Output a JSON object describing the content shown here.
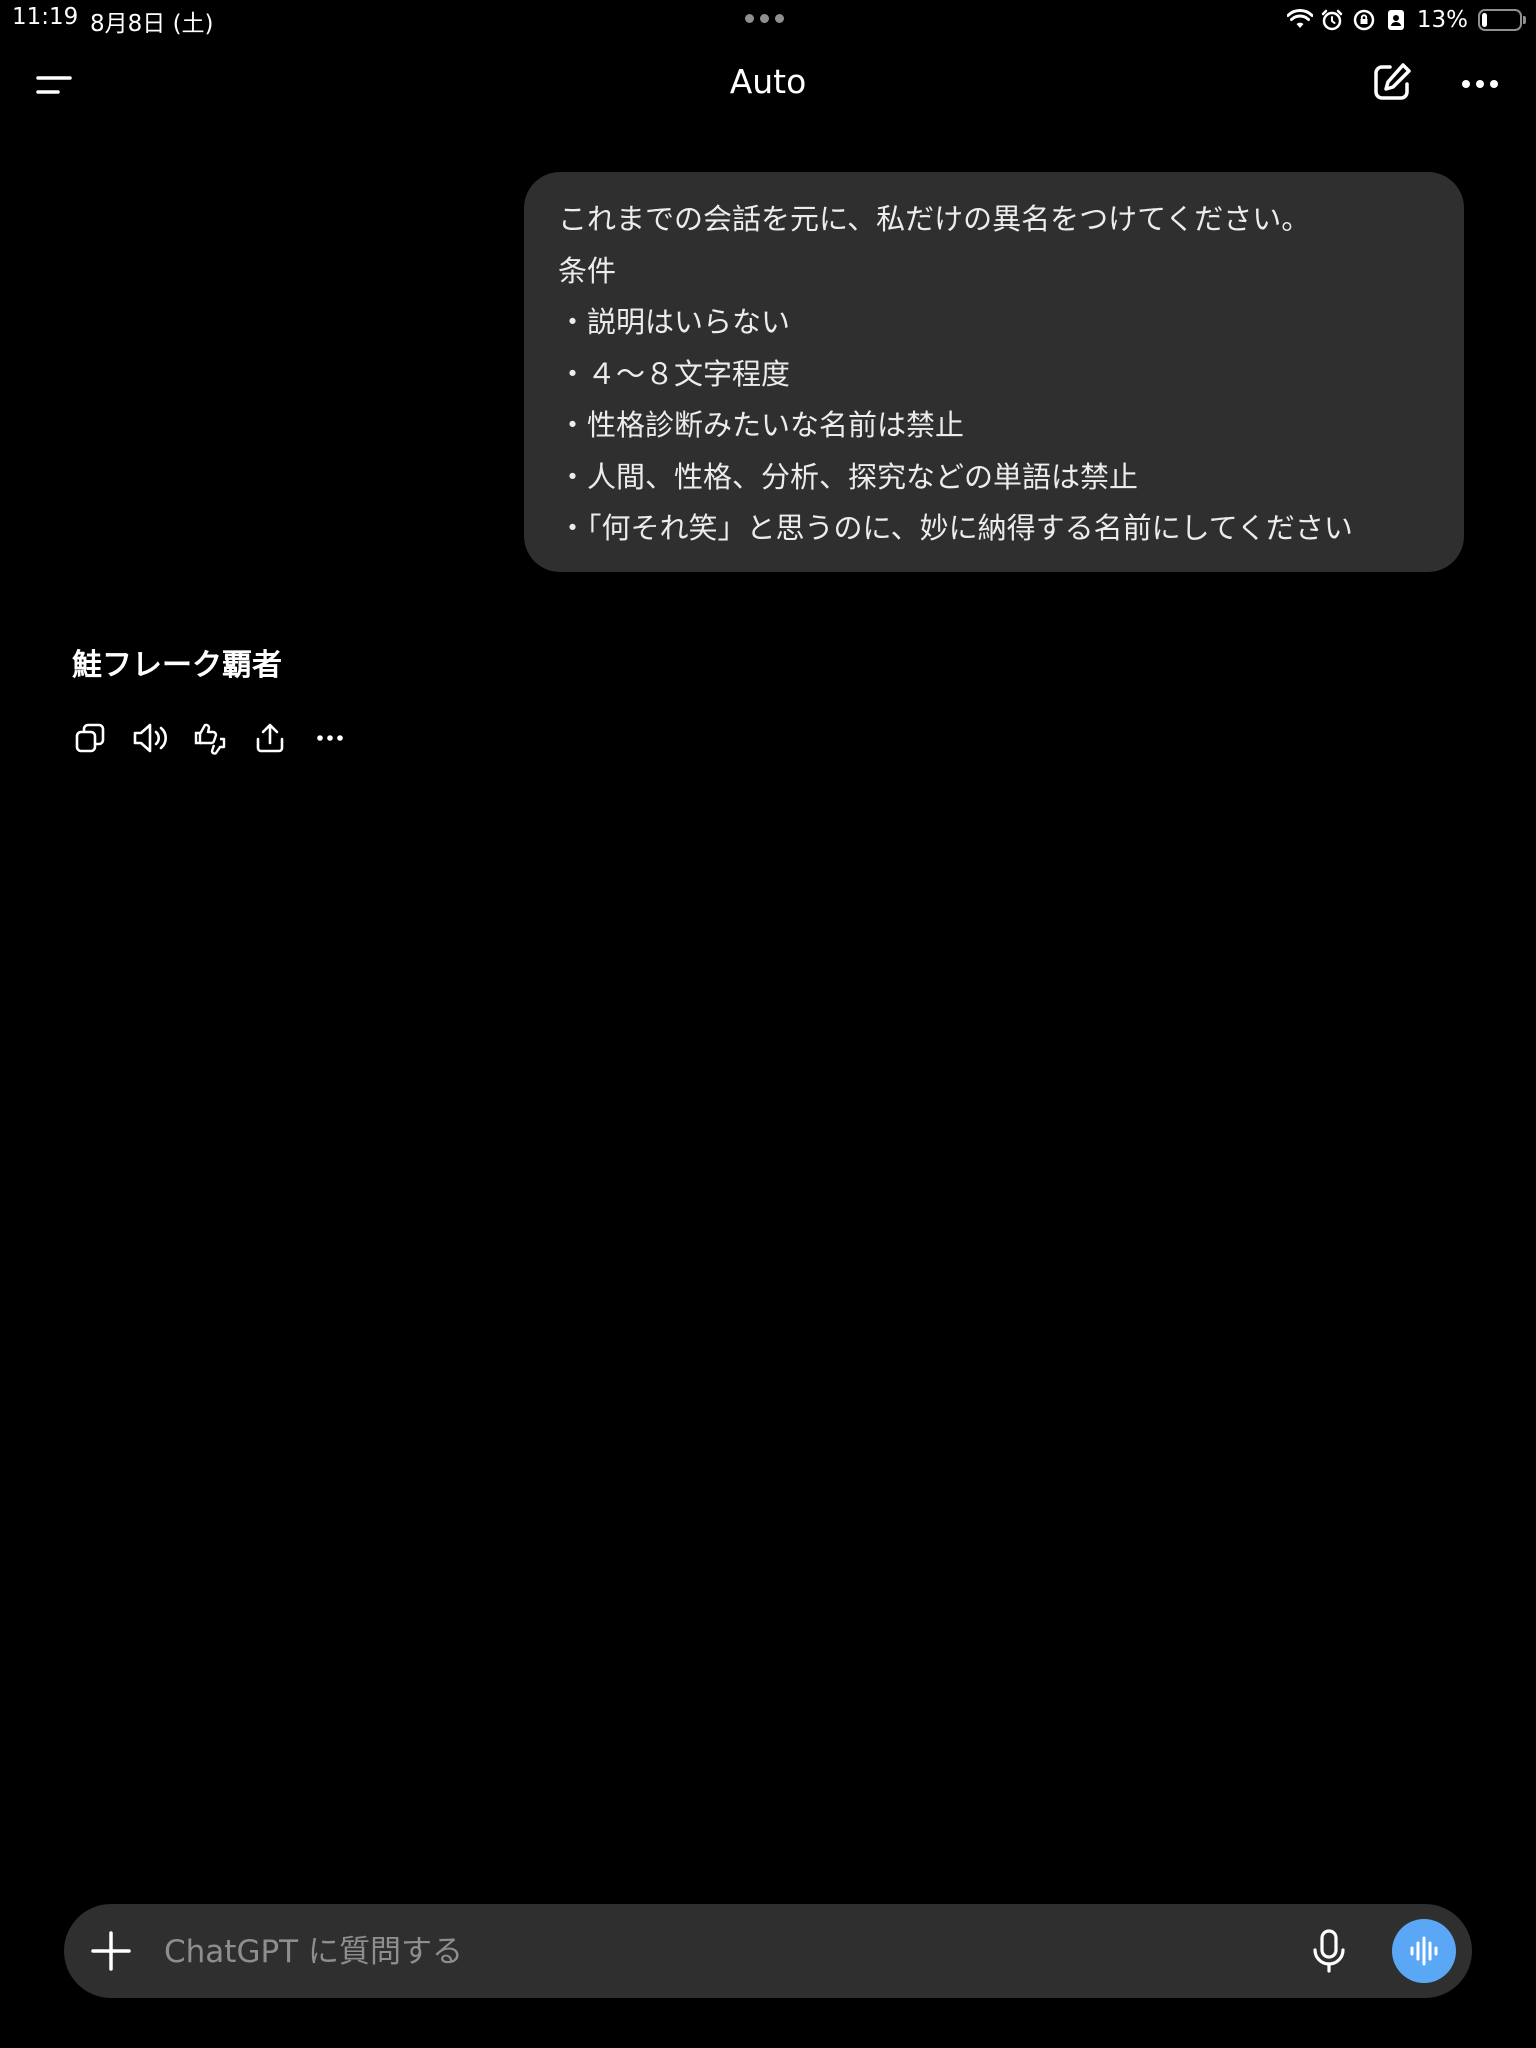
{
  "status_bar": {
    "time": "11:19",
    "date": "8月8日 (土)",
    "battery_percent_label": "13%",
    "battery_level": 0.13,
    "icons": [
      "wifi-icon",
      "alarm-icon",
      "rotation-lock-icon",
      "person-badge-icon"
    ]
  },
  "header": {
    "title": "Auto",
    "icons": [
      "menu-icon",
      "new-chat-icon",
      "ellipsis-icon"
    ]
  },
  "conversation": {
    "user_message": {
      "lines": [
        "これまでの会話を元に、私だけの異名をつけてください。",
        "条件",
        "・説明はいらない",
        "・４〜８文字程度",
        "・性格診断みたいな名前は禁止",
        "・人間、性格、分析、探究などの単語は禁止",
        "・「何それ笑」と思うのに、妙に納得する名前にしてください"
      ]
    },
    "assistant_message": {
      "text": "鮭フレーク覇者",
      "actions": [
        "copy-icon",
        "read-aloud-icon",
        "thumbs-up-down-icon",
        "share-icon",
        "more-icon"
      ]
    }
  },
  "composer": {
    "placeholder": "ChatGPT に質問する",
    "value": "",
    "icons": [
      "plus-icon",
      "microphone-icon",
      "voice-mode-icon"
    ]
  },
  "colors": {
    "background": "#000000",
    "bubble": "#2f2f2f",
    "composer": "#2f2f2f",
    "voice_button": "#5aa8f5",
    "text": "#ffffff",
    "placeholder": "#8e8e8e"
  }
}
